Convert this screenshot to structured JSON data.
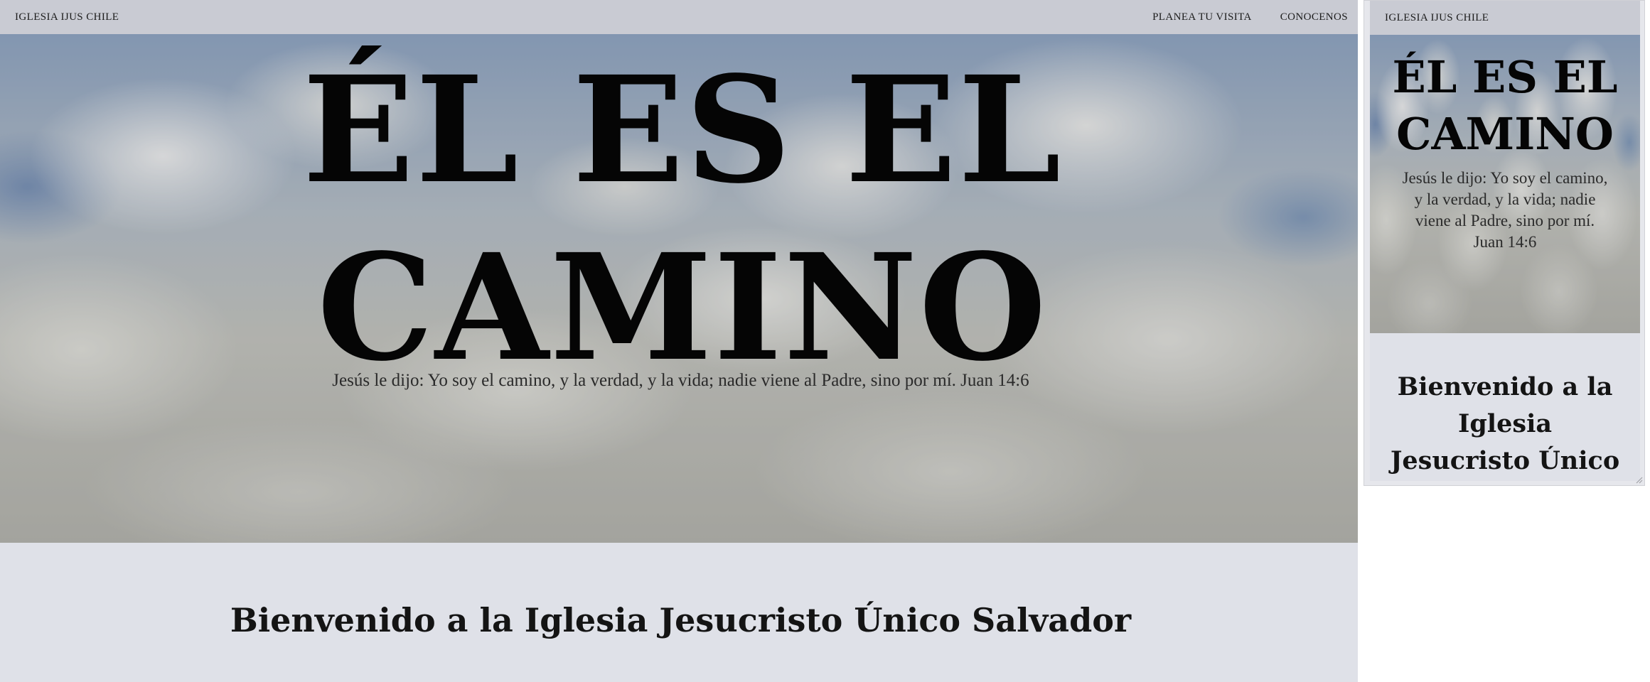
{
  "main": {
    "nav": {
      "brand": "IGLESIA IJUS CHILE",
      "links": [
        "PLANEA TU VISITA",
        "CONOCENOS"
      ]
    },
    "hero": {
      "title": "ÉL ES EL CAMINO",
      "subtitle": "Jesús le dijo: Yo soy el camino, y la verdad, y la vida; nadie viene al Padre, sino por mí. Juan 14:6"
    },
    "welcome": {
      "title": "Bienvenido a la Iglesia Jesucristo Único Salvador"
    }
  },
  "mobile": {
    "nav": {
      "brand": "IGLESIA IJUS CHILE"
    },
    "hero": {
      "title": "ÉL ES EL CAMINO",
      "subtitle": "Jesús le dijo: Yo soy el camino, y la verdad, y la vida; nadie viene al Padre, sino por mí. Juan 14:6"
    },
    "welcome": {
      "title": "Bienvenido a la Iglesia Jesucristo Único Salvador"
    }
  },
  "colors": {
    "nav_bg": "#c9cbd3",
    "page_bg": "#dfe1e8",
    "text": "#141414"
  }
}
